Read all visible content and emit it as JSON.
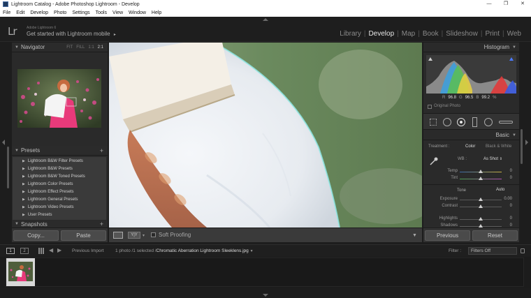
{
  "window": {
    "title": "Lightroom Catalog - Adobe Photoshop Lightroom - Develop",
    "minimize": "—",
    "maximize": "❐",
    "close": "✕"
  },
  "menu": [
    "File",
    "Edit",
    "Develop",
    "Photo",
    "Settings",
    "Tools",
    "View",
    "Window",
    "Help"
  ],
  "identity": {
    "logo": "Lr",
    "product": "Adobe Lightroom 6",
    "tagline": "Get started with Lightroom mobile",
    "tagline_arrow": "▸"
  },
  "modules": {
    "items": [
      "Library",
      "Develop",
      "Map",
      "Book",
      "Slideshow",
      "Print",
      "Web"
    ],
    "active": "Develop"
  },
  "navigator": {
    "title": "Navigator",
    "options": [
      "FIT",
      "FILL",
      "1:1",
      "2:1"
    ],
    "selected": "2:1"
  },
  "presets": {
    "title": "Presets",
    "add": "+",
    "items": [
      "Lightroom B&W Filter Presets",
      "Lightroom B&W Presets",
      "Lightroom B&W Toned Presets",
      "Lightroom Color Presets",
      "Lightroom Effect Presets",
      "Lightroom General Presets",
      "Lightroom Video Presets",
      "User Presets"
    ]
  },
  "snapshots": {
    "title": "Snapshots",
    "add": "+"
  },
  "left_buttons": {
    "copy": "Copy...",
    "paste": "Paste"
  },
  "toolbar": {
    "soft_proofing": "Soft Proofing",
    "view_label": "Y|Y"
  },
  "histogram": {
    "title": "Histogram",
    "r_label": "R",
    "r_value": "96.8",
    "g_label": "G",
    "g_value": "96.5",
    "b_label": "B",
    "b_value": "99.2",
    "unit": "%",
    "original_photo": "Original Photo"
  },
  "basic": {
    "title": "Basic",
    "treatment_label": "Treatment :",
    "treatment_color": "Color",
    "treatment_bw": "Black & White",
    "wb_label": "WB :",
    "wb_value": "As Shot",
    "tone_label": "Tone",
    "tone_auto": "Auto",
    "sliders": [
      {
        "label": "Temp",
        "value": "0",
        "position": 0.5
      },
      {
        "label": "Tint",
        "value": "0",
        "position": 0.5
      },
      {
        "label": "Exposure",
        "value": "0.00",
        "position": 0.5
      },
      {
        "label": "Contrast",
        "value": "0",
        "position": 0.5
      },
      {
        "label": "Highlights",
        "value": "0",
        "position": 0.5
      },
      {
        "label": "Shadows",
        "value": "0",
        "position": 0.5
      }
    ]
  },
  "right_buttons": {
    "previous": "Previous",
    "reset": "Reset"
  },
  "filmbar": {
    "page1": "1",
    "page2": "2",
    "previous_import": "Previous Import",
    "count": "1 photo /1 selected /",
    "filename": "Chromatic Aberration Lightroom Sleeklens.jpg",
    "filter_label": "Filter :",
    "filter_value": "Filters Off"
  },
  "colors": {
    "accent_active": "#e6e6e6",
    "panel_bg": "#2a2a2a",
    "app_bg": "#1d1d1d"
  }
}
